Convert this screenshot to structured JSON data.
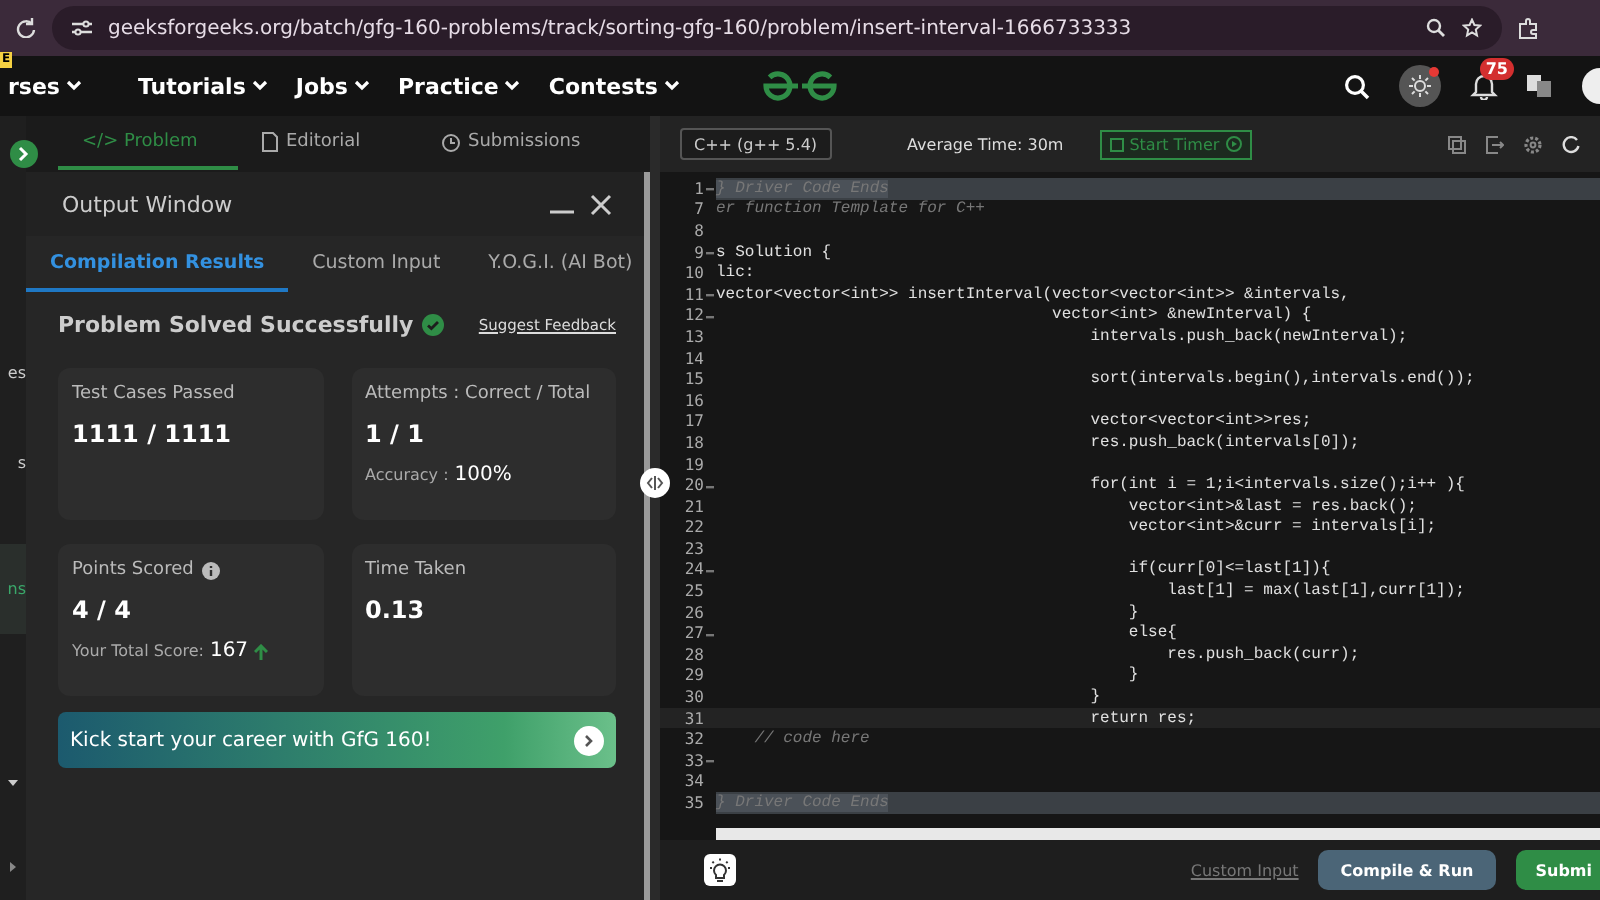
{
  "browser": {
    "url": "geeksforgeeks.org/batch/gfg-160-problems/track/sorting-gfg-160/problem/insert-interval-1666733333"
  },
  "nav": {
    "badge": "E",
    "items": [
      "rses",
      "Tutorials",
      "Jobs",
      "Practice",
      "Contests"
    ],
    "notifications": "75"
  },
  "sidebar": {
    "items": [
      {
        "label": "es",
        "selected": false
      },
      {
        "label": "s",
        "selected": false
      },
      {
        "label": "ns",
        "selected": true
      }
    ]
  },
  "problem_tabs": [
    {
      "label": "</> Problem",
      "selected": true
    },
    {
      "label": "Editorial",
      "selected": false
    },
    {
      "label": "Submissions",
      "selected": false
    }
  ],
  "output": {
    "title": "Output Window",
    "tabs": [
      {
        "label": "Compilation Results",
        "selected": true
      },
      {
        "label": "Custom Input",
        "selected": false
      },
      {
        "label": "Y.O.G.I. (AI Bot)",
        "selected": false
      }
    ],
    "status": "Problem Solved Successfully",
    "feedback": "Suggest Feedback",
    "cards": [
      {
        "title": "Test Cases Passed",
        "value": "1111 / 1111"
      },
      {
        "title": "Attempts : Correct / Total",
        "value": "1 / 1",
        "note_label": "Accuracy :",
        "note_value": "100%"
      },
      {
        "title": "Points Scored",
        "value": "4 / 4",
        "note_label": "Your Total Score:",
        "note_value": "167",
        "info": true,
        "trend": true
      },
      {
        "title": "Time Taken",
        "value": "0.13"
      }
    ],
    "promo": "Kick start your career with GfG 160!"
  },
  "editor": {
    "language": "C++ (g++ 5.4)",
    "average_time": "Average Time: 30m",
    "timer": "Start Timer",
    "lines": [
      {
        "number": "1",
        "kind": "banner",
        "fold": true,
        "text": "} Driver Code Ends"
      },
      {
        "number": "7",
        "kind": "comment",
        "fold": false,
        "text": "er function Template for C++"
      },
      {
        "number": "8",
        "kind": "code",
        "fold": false
      },
      {
        "number": "9",
        "kind": "code",
        "fold": true,
        "text": "s Solution {"
      },
      {
        "number": "10",
        "kind": "code",
        "fold": false,
        "text": "lic:"
      },
      {
        "number": "11",
        "kind": "code",
        "fold": true,
        "text": "vector<vector<int>> insertInterval(vector<vector<int>> &intervals,"
      },
      {
        "number": "12",
        "kind": "code",
        "fold": true,
        "text": "                                   vector<int> &newInterval) {"
      },
      {
        "number": "13",
        "kind": "code",
        "fold": false,
        "text": "                                       intervals.push_back(newInterval);"
      },
      {
        "number": "14",
        "kind": "code",
        "fold": false
      },
      {
        "number": "15",
        "kind": "code",
        "fold": false,
        "text": "                                       sort(intervals.begin(),intervals.end());"
      },
      {
        "number": "16",
        "kind": "code",
        "fold": false
      },
      {
        "number": "17",
        "kind": "code",
        "fold": false,
        "text": "                                       vector<vector<int>>res;"
      },
      {
        "number": "18",
        "kind": "code",
        "fold": false,
        "text": "                                       res.push_back(intervals[0]);"
      },
      {
        "number": "19",
        "kind": "code",
        "fold": false
      },
      {
        "number": "20",
        "kind": "code",
        "fold": true,
        "text": "                                       for(int i = 1;i<intervals.size();i++ ){"
      },
      {
        "number": "21",
        "kind": "code",
        "fold": false,
        "text": "                                           vector<int>&last = res.back();"
      },
      {
        "number": "22",
        "kind": "code",
        "fold": false,
        "text": "                                           vector<int>&curr = intervals[i];"
      },
      {
        "number": "23",
        "kind": "code",
        "fold": false
      },
      {
        "number": "24",
        "kind": "code",
        "fold": true,
        "text": "                                           if(curr[0]<=last[1]){"
      },
      {
        "number": "25",
        "kind": "code",
        "fold": false,
        "text": "                                               last[1] = max(last[1],curr[1]);"
      },
      {
        "number": "26",
        "kind": "code",
        "fold": false,
        "text": "                                           }"
      },
      {
        "number": "27",
        "kind": "code",
        "fold": true,
        "text": "                                           else{"
      },
      {
        "number": "28",
        "kind": "code",
        "fold": false,
        "text": "                                               res.push_back(curr);"
      },
      {
        "number": "29",
        "kind": "code",
        "fold": false,
        "text": "                                           }"
      },
      {
        "number": "30",
        "kind": "code",
        "fold": false,
        "text": "                                       }"
      },
      {
        "number": "31",
        "kind": "current",
        "fold": false,
        "text": "                                       return res;"
      },
      {
        "number": "32",
        "kind": "comment",
        "fold": false,
        "text": "    // code here"
      },
      {
        "number": "33",
        "kind": "code",
        "fold": true
      },
      {
        "number": "34",
        "kind": "code",
        "fold": false
      },
      {
        "number": "35",
        "kind": "banner",
        "fold": false,
        "text": "} Driver Code Ends"
      }
    ],
    "custom_input": "Custom Input",
    "compile": "Compile & Run",
    "submit": "Submi"
  }
}
